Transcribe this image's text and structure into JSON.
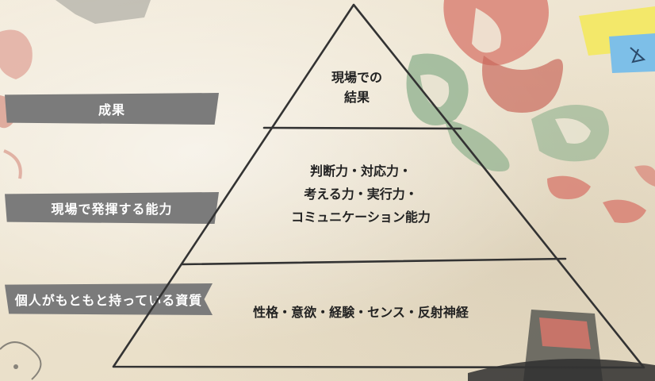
{
  "labels": [
    {
      "text": "成果"
    },
    {
      "text": "現場で発揮する能力"
    },
    {
      "text": "個人がもともと持っている資質"
    }
  ],
  "pyramid": {
    "top": [
      "現場での",
      "結果"
    ],
    "middle": [
      "判断力・対応力・",
      "考える力・実行力・",
      "コミュニケーション能力"
    ],
    "bottom": [
      "性格・意欲・経験・センス・反射神経"
    ]
  },
  "colors": {
    "tape": "#7b7b7b",
    "line": "#333333",
    "accent_red": "#d7756a",
    "accent_green": "#8eb08d",
    "sticky_yellow": "#f3e86a",
    "sticky_blue": "#7dbfe8"
  },
  "icons": [
    "tribal-art-decoration",
    "sticky-note",
    "sticker-decoration"
  ]
}
